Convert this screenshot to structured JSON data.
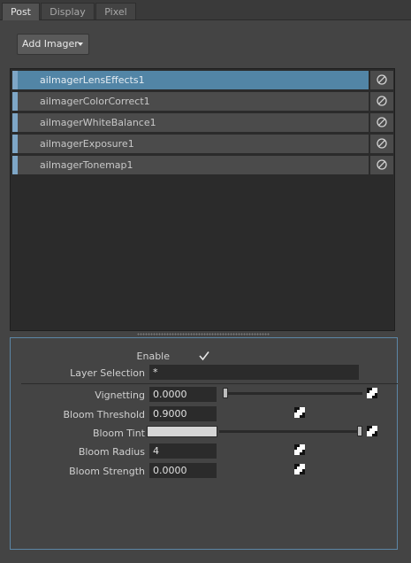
{
  "tabs": [
    {
      "label": "Post",
      "active": true
    },
    {
      "label": "Display",
      "active": false
    },
    {
      "label": "Pixel",
      "active": false
    }
  ],
  "add_imager_label": "Add Imager",
  "imagers": [
    {
      "name": "aiImagerLensEffects1",
      "selected": true,
      "bypass_icon": "bypass-icon"
    },
    {
      "name": "aiImagerColorCorrect1",
      "selected": false,
      "bypass_icon": "bypass-icon"
    },
    {
      "name": "aiImagerWhiteBalance1",
      "selected": false,
      "bypass_icon": "bypass-icon"
    },
    {
      "name": "aiImagerExposure1",
      "selected": false,
      "bypass_icon": "bypass-icon"
    },
    {
      "name": "aiImagerTonemap1",
      "selected": false,
      "bypass_icon": "bypass-icon"
    }
  ],
  "attributes": {
    "enable": {
      "label": "Enable",
      "checked": true
    },
    "layer_selection": {
      "label": "Layer Selection",
      "value": "*"
    },
    "vignetting": {
      "label": "Vignetting",
      "value": "0.0000",
      "slider_fraction": 0.0
    },
    "bloom_threshold": {
      "label": "Bloom Threshold",
      "value": "0.9000"
    },
    "bloom_tint": {
      "label": "Bloom Tint",
      "color": "#d6d6d6",
      "slider_fraction": 1.0
    },
    "bloom_radius": {
      "label": "Bloom Radius",
      "value": "4"
    },
    "bloom_strength": {
      "label": "Bloom Strength",
      "value": "0.0000"
    }
  },
  "colors": {
    "selection": "#5285a6",
    "row_accent": "#7ea6c6",
    "panel_border": "#5c86a6"
  }
}
